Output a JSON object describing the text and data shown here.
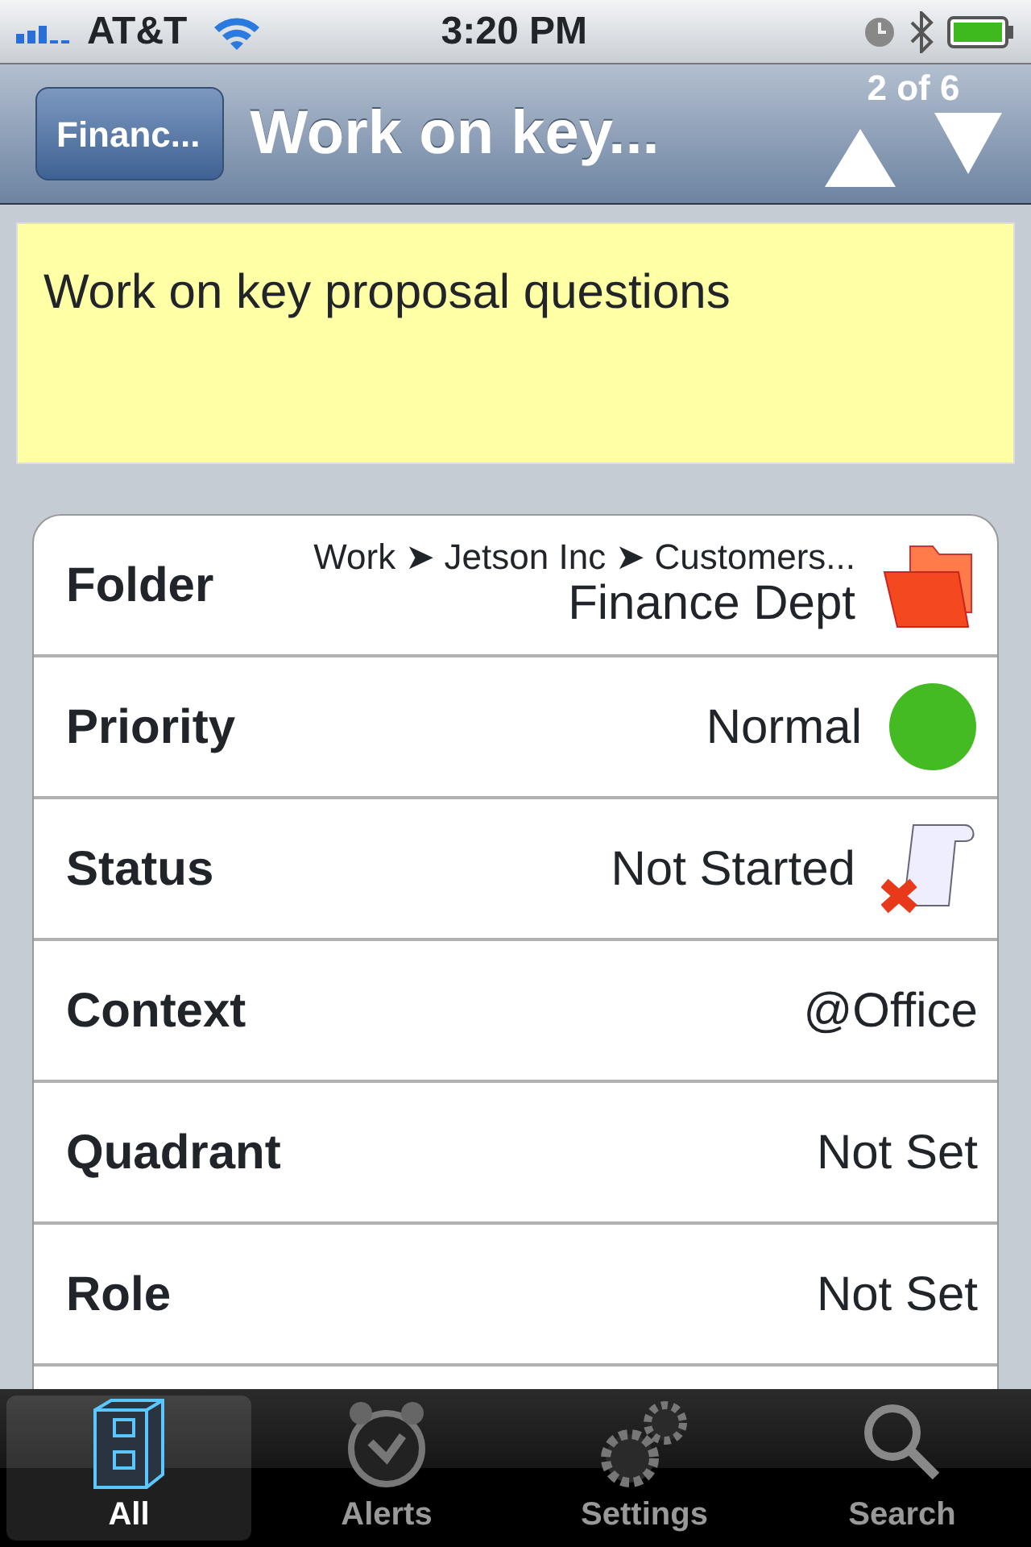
{
  "status_bar": {
    "carrier": "AT&T",
    "time": "3:20 PM"
  },
  "nav_bar": {
    "back": "Financ...",
    "title": "Work on key...",
    "counter": "2 of 6"
  },
  "note": "Work on key proposal questions",
  "fields": [
    {
      "label": "Folder",
      "path": "Work ➤ Jetson Inc ➤ Customers...",
      "value": "Finance Dept",
      "kind": "folder"
    },
    {
      "label": "Priority",
      "value": "Normal",
      "kind": "dot",
      "color": "#44bb22"
    },
    {
      "label": "Status",
      "value": "Not Started",
      "kind": "scroll"
    },
    {
      "label": "Context",
      "value": "@Office"
    },
    {
      "label": "Quadrant",
      "value": "Not Set"
    },
    {
      "label": "Role",
      "value": "Not Set"
    }
  ],
  "tabs": [
    {
      "label": "All",
      "selected": true
    },
    {
      "label": "Alerts",
      "selected": false
    },
    {
      "label": "Settings",
      "selected": false
    },
    {
      "label": "Search",
      "selected": false
    }
  ]
}
